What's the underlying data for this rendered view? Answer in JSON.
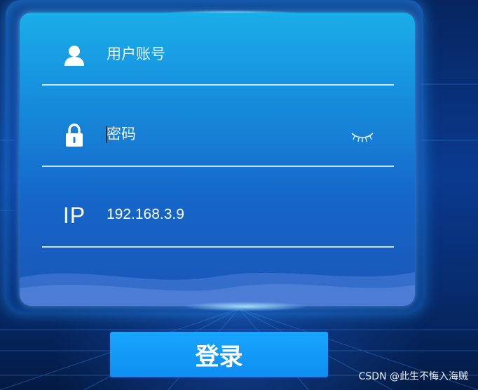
{
  "login_form": {
    "username": {
      "icon": "user-icon",
      "placeholder": "用户账号",
      "value": ""
    },
    "password": {
      "icon": "lock-icon",
      "placeholder": "密码",
      "value": "",
      "toggle_icon": "eye-closed-icon"
    },
    "ip": {
      "icon_label": "IP",
      "value": "192.168.3.9"
    },
    "login_button_label": "登录"
  },
  "watermark": "CSDN @此生不悔入海贼",
  "colors": {
    "panel_top": "#1aaeea",
    "panel_bottom": "#1a56b6",
    "button": "#129bf8",
    "background": "#0a3a8f"
  }
}
